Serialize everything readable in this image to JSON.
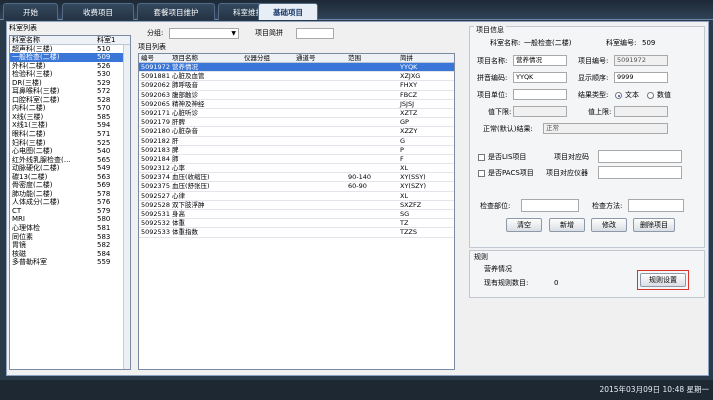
{
  "tabs": [
    "开始",
    "收费项目",
    "套餐项目维护",
    "科室维护",
    "基础项目"
  ],
  "dept_section_title": "科室列表",
  "dept_headers": [
    "科室名称",
    "科室1"
  ],
  "departments": [
    {
      "name": "超声科(三楼)",
      "code": "510"
    },
    {
      "name": "一般检查(二楼)",
      "code": "509"
    },
    {
      "name": "外科(二楼)",
      "code": "526"
    },
    {
      "name": "检验科(三楼)",
      "code": "530"
    },
    {
      "name": "DR(三楼)",
      "code": "529"
    },
    {
      "name": "耳鼻喉科(三楼)",
      "code": "572"
    },
    {
      "name": "口腔科室(二楼)",
      "code": "528"
    },
    {
      "name": "内科(二楼)",
      "code": "570"
    },
    {
      "name": "X线(三楼)",
      "code": "585"
    },
    {
      "name": "X线1(三楼)",
      "code": "594"
    },
    {
      "name": "眼科(二楼)",
      "code": "571"
    },
    {
      "name": "妇科(三楼)",
      "code": "525"
    },
    {
      "name": "心电图(二楼)",
      "code": "540"
    },
    {
      "name": "红外线乳腺检查(…",
      "code": "565"
    },
    {
      "name": "动脉硬化(二楼)",
      "code": "549"
    },
    {
      "name": "碳13(二楼)",
      "code": "563"
    },
    {
      "name": "骨密度(二楼)",
      "code": "569"
    },
    {
      "name": "肺功能(二楼)",
      "code": "578"
    },
    {
      "name": "人体成分(二楼)",
      "code": "576"
    },
    {
      "name": "CT",
      "code": "579"
    },
    {
      "name": "MRI",
      "code": "580"
    },
    {
      "name": "心理体检",
      "code": "581"
    },
    {
      "name": "同位素",
      "code": "583"
    },
    {
      "name": "胃镜",
      "code": "582"
    },
    {
      "name": "核磁",
      "code": "584"
    },
    {
      "name": "多普勒科室",
      "code": "559"
    }
  ],
  "filter": {
    "group_label": "分组:",
    "pinyin_label": "项目简拼",
    "group_value": "",
    "pinyin_value": ""
  },
  "item_section_title": "项目列表",
  "item_headers": [
    "编号",
    "项目名称",
    "仪器分组",
    "通道号",
    "范围",
    "简拼"
  ],
  "items": [
    {
      "code": "5091972",
      "name": "营养情况",
      "inst": "",
      "chan": "",
      "range": "",
      "py": "YYQK"
    },
    {
      "code": "5091881",
      "name": "心脏及血管",
      "inst": "",
      "chan": "",
      "range": "",
      "py": "XZJXG"
    },
    {
      "code": "5092062",
      "name": "肺呼吸音",
      "inst": "",
      "chan": "",
      "range": "",
      "py": "FHXY"
    },
    {
      "code": "5092063",
      "name": "腹部触诊",
      "inst": "",
      "chan": "",
      "range": "",
      "py": "FBCZ"
    },
    {
      "code": "5092065",
      "name": "精神及神经",
      "inst": "",
      "chan": "",
      "range": "",
      "py": "JSJSJ"
    },
    {
      "code": "5092171",
      "name": "心脏听诊",
      "inst": "",
      "chan": "",
      "range": "",
      "py": "XZTZ"
    },
    {
      "code": "5092179",
      "name": "肝脾",
      "inst": "",
      "chan": "",
      "range": "",
      "py": "GP"
    },
    {
      "code": "5092180",
      "name": "心脏杂音",
      "inst": "",
      "chan": "",
      "range": "",
      "py": "XZZY"
    },
    {
      "code": "5092182",
      "name": "肝",
      "inst": "",
      "chan": "",
      "range": "",
      "py": "G"
    },
    {
      "code": "5092183",
      "name": "脾",
      "inst": "",
      "chan": "",
      "range": "",
      "py": "P"
    },
    {
      "code": "5092184",
      "name": "肺",
      "inst": "",
      "chan": "",
      "range": "",
      "py": "F"
    },
    {
      "code": "5092312",
      "name": "心率",
      "inst": "",
      "chan": "",
      "range": "",
      "py": "XL"
    },
    {
      "code": "5092374",
      "name": "血压(收缩压)",
      "inst": "",
      "chan": "",
      "range": "90-140",
      "py": "XY(SSY)"
    },
    {
      "code": "5092375",
      "name": "血压(舒张压)",
      "inst": "",
      "chan": "",
      "range": "60-90",
      "py": "XY(SZY)"
    },
    {
      "code": "5092527",
      "name": "心律",
      "inst": "",
      "chan": "",
      "range": "",
      "py": "XL"
    },
    {
      "code": "5092528",
      "name": "双下肢浮肿",
      "inst": "",
      "chan": "",
      "range": "",
      "py": "SXZFZ"
    },
    {
      "code": "5092531",
      "name": "身高",
      "inst": "",
      "chan": "",
      "range": "",
      "py": "SG"
    },
    {
      "code": "5092532",
      "name": "体重",
      "inst": "",
      "chan": "",
      "range": "",
      "py": "TZ"
    },
    {
      "code": "5092533",
      "name": "体重指数",
      "inst": "",
      "chan": "",
      "range": "",
      "py": "TZZS"
    }
  ],
  "info": {
    "title": "项目信息",
    "dept_name_label": "科室名称:",
    "dept_name": "一般检查(二楼)",
    "dept_code_label": "科室编号:",
    "dept_code": "509",
    "item_name_label": "项目名称:",
    "item_name": "营养情况",
    "item_code_label": "项目编号:",
    "item_code": "5091972",
    "pinyin_label": "拼音编码:",
    "pinyin": "YYQK",
    "display_order_label": "显示顺序:",
    "display_order": "9999",
    "unit_label": "项目单位:",
    "unit": "",
    "result_type_label": "结果类型:",
    "result_text": "文本",
    "result_numeric": "数值",
    "lower_label": "值下限:",
    "lower": "",
    "upper_label": "值上限:",
    "upper": "",
    "normal_label": "正常(默认)结果:",
    "normal": "正常",
    "lis_label": "是否LIS项目",
    "lis_code_label": "项目对应码",
    "lis_code": "",
    "pacs_label": "是否PACS项目",
    "pacs_code_label": "项目对应仪器",
    "pacs_code": "",
    "part_label": "检查部位:",
    "part": "",
    "method_label": "检查方法:",
    "method": "",
    "btn_clear": "清空",
    "btn_add": "新增",
    "btn_edit": "修改",
    "btn_delete": "删除项目"
  },
  "rules": {
    "title": "规则",
    "item": "营养情况",
    "count_label": "现有规则数目:",
    "count": "0",
    "btn": "规则设置"
  },
  "status": {
    "datetime": "2015年03月09日 10:48 星期一"
  }
}
